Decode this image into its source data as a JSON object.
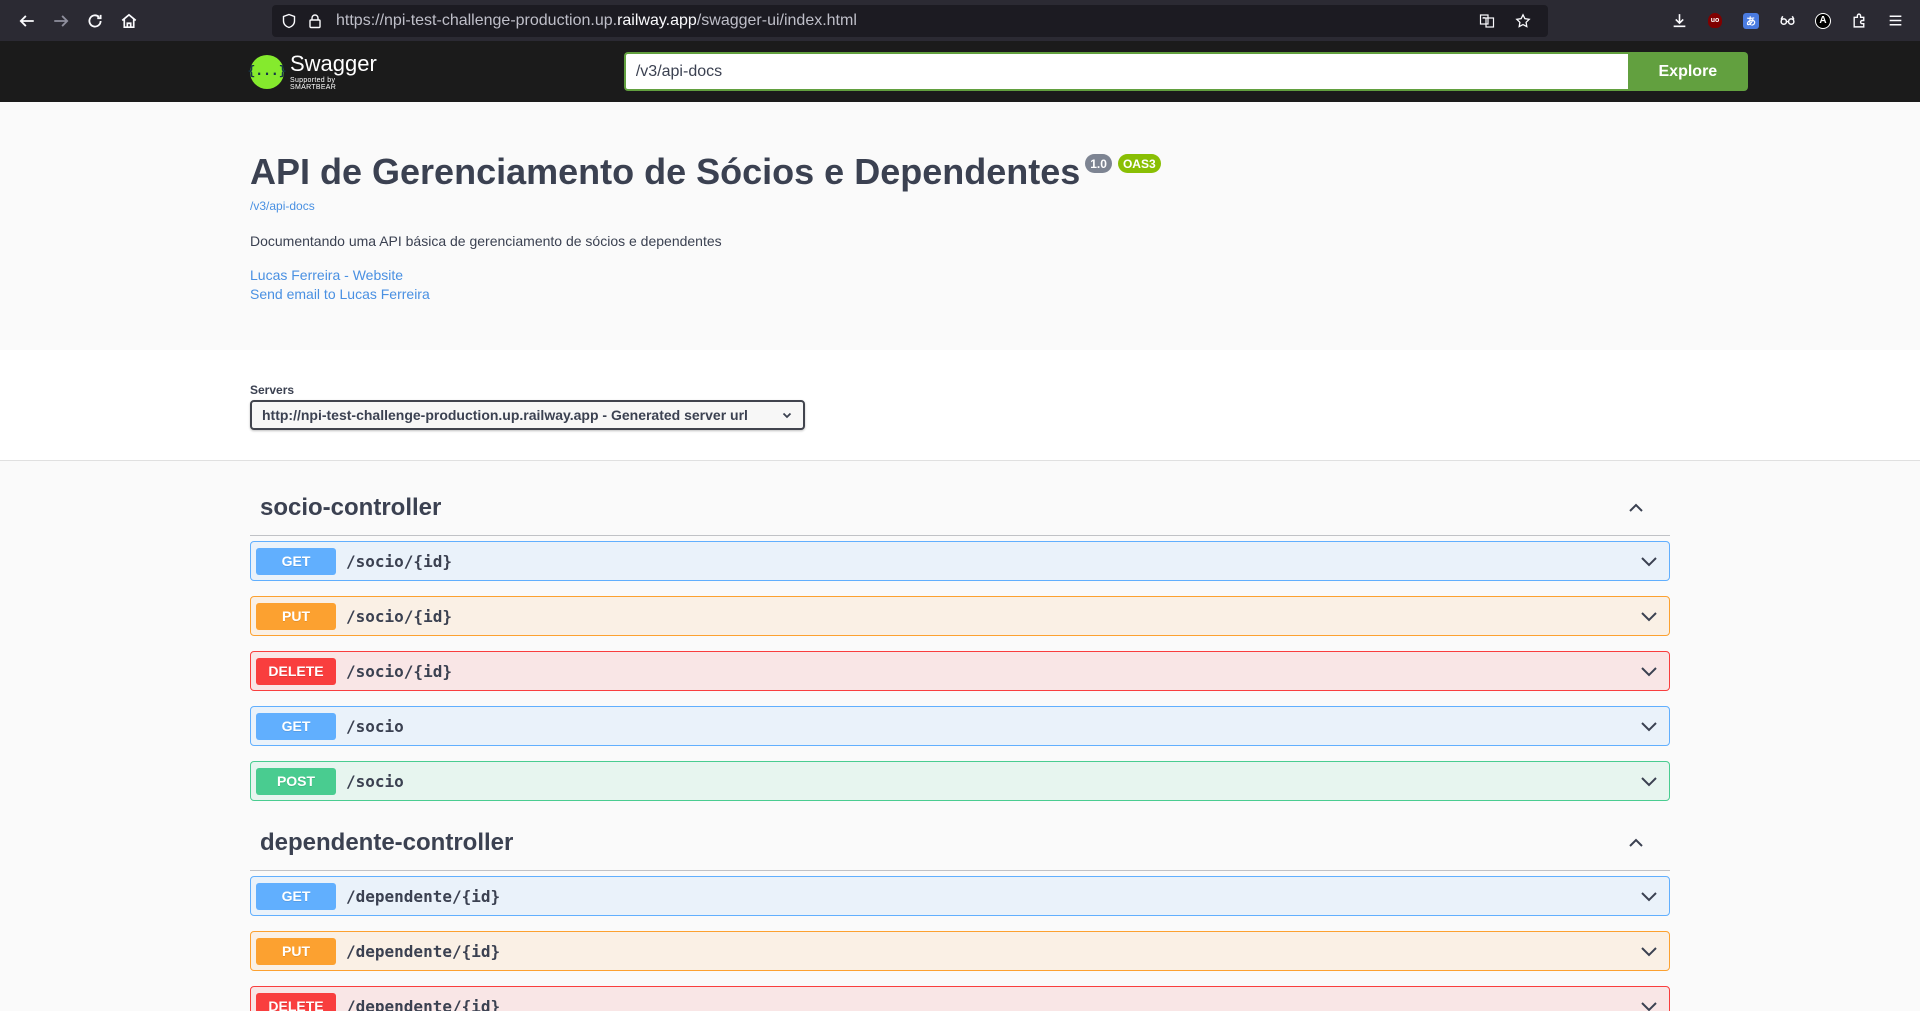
{
  "browser": {
    "url_prefix": "https://npi-test-challenge-production.up.",
    "url_domain": "railway.app",
    "url_suffix": "/swagger-ui/index.html"
  },
  "topbar": {
    "logo_name": "Swagger",
    "logo_sub": "Supported by SMARTBEAR",
    "logo_mark": "{...}",
    "explore_value": "/v3/api-docs",
    "explore_label": "Explore"
  },
  "info": {
    "title": "API de Gerenciamento de Sócios e Dependentes",
    "version": "1.0",
    "oas": "OAS3",
    "spec_url": "/v3/api-docs",
    "description": "Documentando uma API básica de gerenciamento de sócios e dependentes",
    "website_link": "Lucas Ferreira - Website",
    "email_link": "Send email to Lucas Ferreira"
  },
  "servers": {
    "label": "Servers",
    "selected": "http://npi-test-challenge-production.up.railway.app - Generated server url"
  },
  "tags": [
    {
      "name": "socio-controller",
      "ops": [
        {
          "method": "GET",
          "path": "/socio/{id}"
        },
        {
          "method": "PUT",
          "path": "/socio/{id}"
        },
        {
          "method": "DELETE",
          "path": "/socio/{id}"
        },
        {
          "method": "GET",
          "path": "/socio"
        },
        {
          "method": "POST",
          "path": "/socio"
        }
      ]
    },
    {
      "name": "dependente-controller",
      "ops": [
        {
          "method": "GET",
          "path": "/dependente/{id}"
        },
        {
          "method": "PUT",
          "path": "/dependente/{id}"
        },
        {
          "method": "DELETE",
          "path": "/dependente/{id}"
        }
      ]
    }
  ],
  "colors": {
    "get": "#61affe",
    "put": "#fca130",
    "delete": "#f93e3e",
    "post": "#49cc90",
    "explore": "#62a03f"
  }
}
